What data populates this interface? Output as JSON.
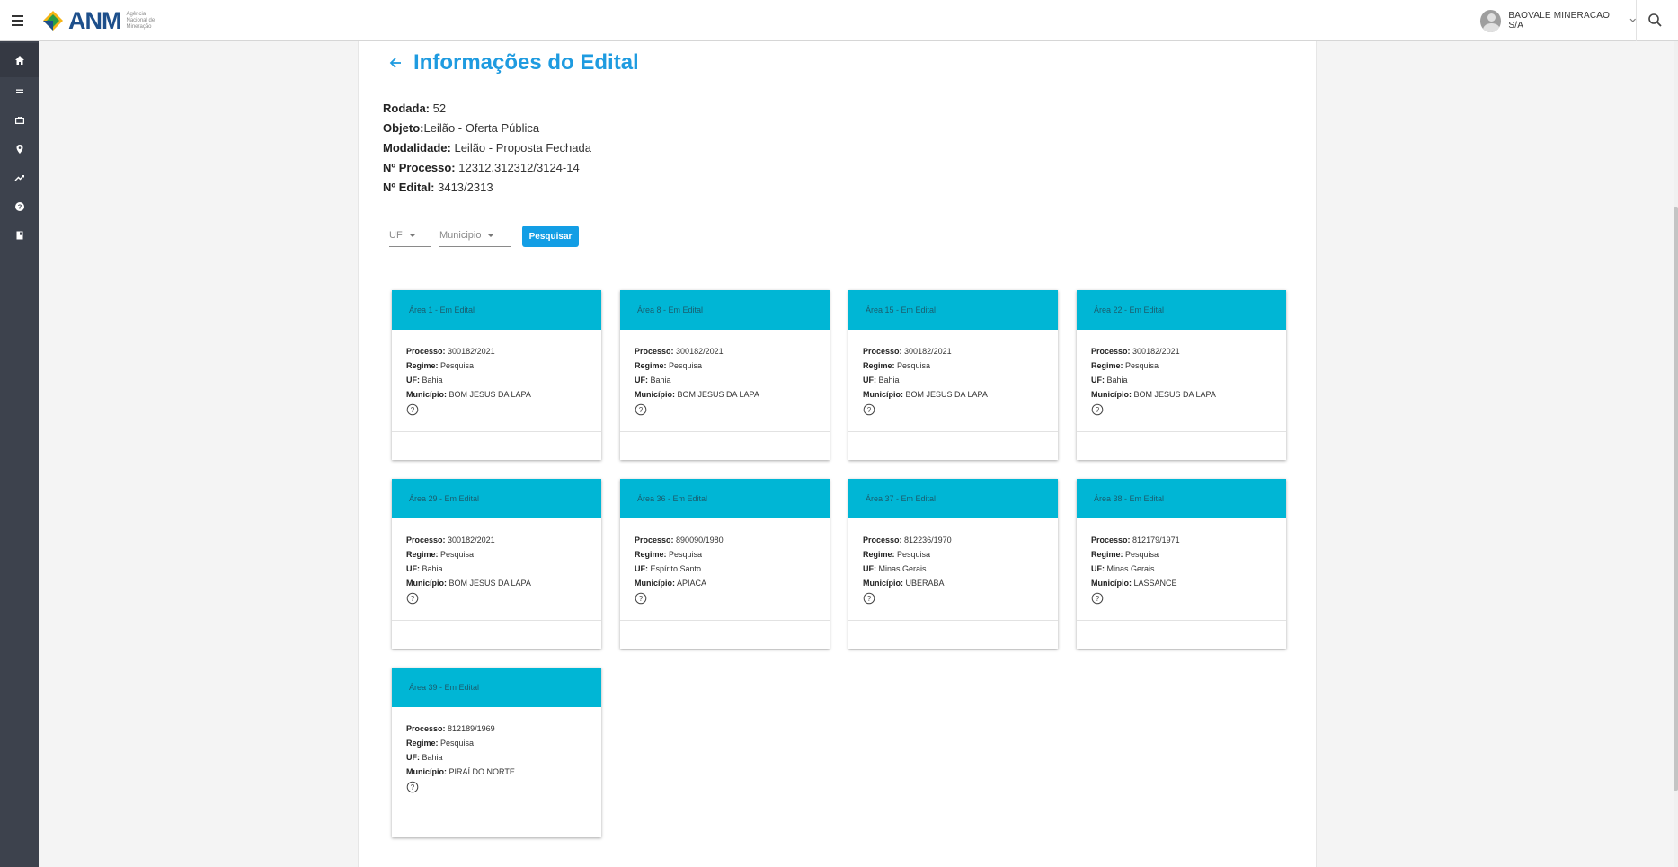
{
  "header": {
    "logo_text": "ANM",
    "logo_sub": "Agência Nacional de Mineração",
    "user_name": "BAOVALE MINERACAO S/A"
  },
  "sidebar": {
    "items": [
      {
        "icon": "home-icon"
      },
      {
        "icon": "menu-lines-icon"
      },
      {
        "icon": "briefcase-icon"
      },
      {
        "icon": "location-pin-icon"
      },
      {
        "icon": "trending-icon"
      },
      {
        "icon": "help-circle-icon"
      },
      {
        "icon": "book-icon"
      }
    ]
  },
  "page": {
    "title": "Informações do Edital",
    "info": {
      "rodada_label": "Rodada:",
      "rodada_value": "52",
      "objeto_label": "Objeto:",
      "objeto_value": "Leilão - Oferta Pública",
      "modalidade_label": "Modalidade:",
      "modalidade_value": "Leilão - Proposta Fechada",
      "processo_label": "Nº Processo:",
      "processo_value": "12312.312312/3124-14",
      "edital_label": "Nº Edital:",
      "edital_value": "3413/2313"
    },
    "filters": {
      "uf_label": "UF",
      "municipio_label": "Municipio",
      "search_button": "Pesquisar"
    }
  },
  "labels": {
    "processo": "Processo:",
    "regime": "Regime:",
    "uf": "UF:",
    "municipio": "Município:"
  },
  "cards": [
    {
      "title": "Área 1 - Em Edital",
      "processo": "300182/2021",
      "regime": "Pesquisa",
      "uf": "Bahia",
      "municipio": "BOM JESUS DA LAPA"
    },
    {
      "title": "Área 8 - Em Edital",
      "processo": "300182/2021",
      "regime": "Pesquisa",
      "uf": "Bahia",
      "municipio": "BOM JESUS DA LAPA"
    },
    {
      "title": "Área 15 - Em Edital",
      "processo": "300182/2021",
      "regime": "Pesquisa",
      "uf": "Bahia",
      "municipio": "BOM JESUS DA LAPA"
    },
    {
      "title": "Área 22 - Em Edital",
      "processo": "300182/2021",
      "regime": "Pesquisa",
      "uf": "Bahia",
      "municipio": "BOM JESUS DA LAPA"
    },
    {
      "title": "Área 29 - Em Edital",
      "processo": "300182/2021",
      "regime": "Pesquisa",
      "uf": "Bahia",
      "municipio": "BOM JESUS DA LAPA"
    },
    {
      "title": "Área 36 - Em Edital",
      "processo": "890090/1980",
      "regime": "Pesquisa",
      "uf": "Espírito Santo",
      "municipio": "APIACÁ"
    },
    {
      "title": "Área 37 - Em Edital",
      "processo": "812236/1970",
      "regime": "Pesquisa",
      "uf": "Minas Gerais",
      "municipio": "UBERABA"
    },
    {
      "title": "Área 38 - Em Edital",
      "processo": "812179/1971",
      "regime": "Pesquisa",
      "uf": "Minas Gerais",
      "municipio": "LASSANCE"
    },
    {
      "title": "Área 39 - Em Edital",
      "processo": "812189/1969",
      "regime": "Pesquisa",
      "uf": "Bahia",
      "municipio": "PIRAÍ DO NORTE"
    }
  ],
  "colors": {
    "accent": "#1e9be0",
    "card_header": "#00b6d5",
    "sidebar": "#3d424d",
    "button": "#139ee5"
  }
}
